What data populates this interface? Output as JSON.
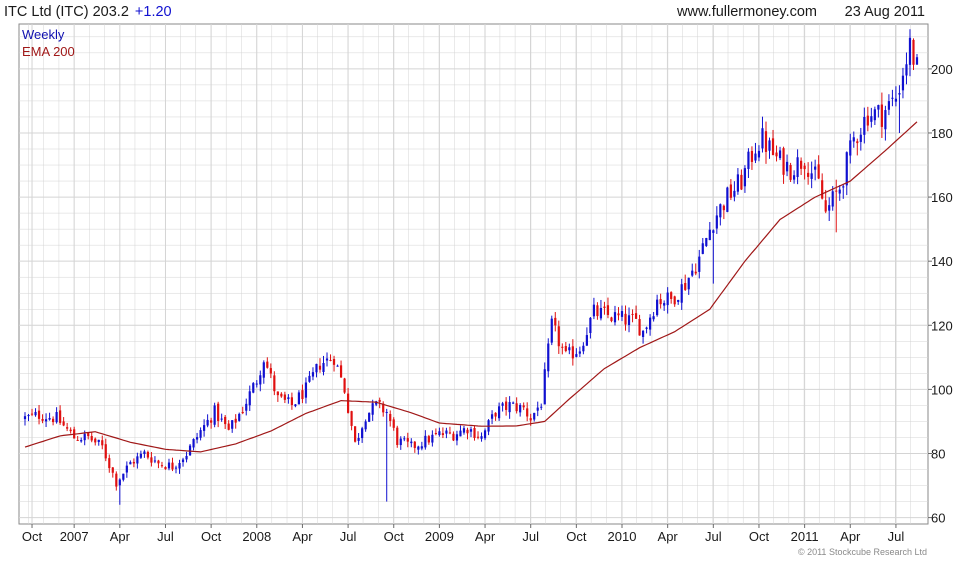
{
  "header": {
    "ticker_text": "ITC Ltd (ITC) 203.2",
    "change_text": "+1.20",
    "website": "www.fullermoney.com",
    "date": "23 Aug 2011"
  },
  "legend": {
    "period": "Weekly",
    "ema": "EMA 200"
  },
  "footer": {
    "copyright": "© 2011 Stockcube Research Ltd"
  },
  "colors": {
    "up": "#1010d0",
    "down": "#e01010",
    "ema": "#a01818",
    "grid": "#d4d4d4",
    "change_text": "#1010d0",
    "legend_period": "#1010b0",
    "legend_ema": "#a01818"
  },
  "chart_data": {
    "type": "candlestick",
    "title": "ITC Ltd (ITC) 203.2 +1.20",
    "period": "Weekly",
    "ylim": [
      58,
      214
    ],
    "y_ticks": [
      60,
      80,
      100,
      120,
      140,
      160,
      180,
      200
    ],
    "x_ticks": [
      "Oct",
      "2007",
      "Apr",
      "Jul",
      "Oct",
      "2008",
      "Apr",
      "Jul",
      "Oct",
      "2009",
      "Apr",
      "Jul",
      "Oct",
      "2010",
      "Apr",
      "Jul",
      "Oct",
      "2011",
      "Apr",
      "Jul"
    ],
    "weeks": 255,
    "tick_weeks": [
      2,
      14,
      27,
      40,
      53,
      66,
      79,
      92,
      105,
      118,
      131,
      144,
      157,
      170,
      183,
      196,
      209,
      222,
      235,
      248
    ],
    "price_anchors": [
      [
        0,
        91
      ],
      [
        4,
        92
      ],
      [
        9,
        91
      ],
      [
        14,
        85
      ],
      [
        18,
        85
      ],
      [
        22,
        82
      ],
      [
        26,
        71
      ],
      [
        30,
        77
      ],
      [
        34,
        80
      ],
      [
        38,
        77
      ],
      [
        42,
        76
      ],
      [
        46,
        80
      ],
      [
        50,
        87
      ],
      [
        54,
        93
      ],
      [
        58,
        87
      ],
      [
        62,
        94
      ],
      [
        66,
        103
      ],
      [
        68,
        110
      ],
      [
        72,
        97
      ],
      [
        76,
        95
      ],
      [
        80,
        100
      ],
      [
        84,
        108
      ],
      [
        88,
        110
      ],
      [
        91,
        100
      ],
      [
        94,
        83
      ],
      [
        97,
        92
      ],
      [
        100,
        95
      ],
      [
        103,
        93
      ],
      [
        106,
        84
      ],
      [
        110,
        82
      ],
      [
        114,
        84
      ],
      [
        118,
        86
      ],
      [
        122,
        86
      ],
      [
        126,
        88
      ],
      [
        130,
        85
      ],
      [
        134,
        93
      ],
      [
        138,
        95
      ],
      [
        142,
        94
      ],
      [
        144,
        91
      ],
      [
        147,
        96
      ],
      [
        150,
        120
      ],
      [
        154,
        110
      ],
      [
        158,
        113
      ],
      [
        162,
        124
      ],
      [
        166,
        123
      ],
      [
        170,
        122
      ],
      [
        174,
        121
      ],
      [
        176,
        118
      ],
      [
        180,
        128
      ],
      [
        184,
        128
      ],
      [
        188,
        133
      ],
      [
        192,
        141
      ],
      [
        196,
        153
      ],
      [
        200,
        160
      ],
      [
        204,
        165
      ],
      [
        208,
        176
      ],
      [
        210,
        178
      ],
      [
        214,
        172
      ],
      [
        218,
        169
      ],
      [
        222,
        172
      ],
      [
        226,
        164
      ],
      [
        228,
        155
      ],
      [
        232,
        163
      ],
      [
        236,
        178
      ],
      [
        240,
        186
      ],
      [
        244,
        186
      ],
      [
        248,
        191
      ],
      [
        252,
        207
      ],
      [
        254,
        200
      ]
    ],
    "ema_anchors": [
      [
        0,
        82
      ],
      [
        10,
        85.5
      ],
      [
        20,
        86.8
      ],
      [
        30,
        83.5
      ],
      [
        40,
        81.3
      ],
      [
        50,
        80.5
      ],
      [
        60,
        83
      ],
      [
        70,
        87
      ],
      [
        80,
        92.5
      ],
      [
        90,
        96.5
      ],
      [
        100,
        96
      ],
      [
        110,
        92.7
      ],
      [
        118,
        89.5
      ],
      [
        130,
        88.5
      ],
      [
        140,
        88.6
      ],
      [
        148,
        90
      ],
      [
        155,
        97
      ],
      [
        165,
        106.5
      ],
      [
        175,
        113
      ],
      [
        185,
        118
      ],
      [
        195,
        125
      ],
      [
        205,
        140
      ],
      [
        215,
        153
      ],
      [
        225,
        160
      ],
      [
        235,
        165
      ],
      [
        245,
        174.5
      ],
      [
        254,
        183.5
      ]
    ],
    "wick_spikes": [
      [
        27,
        64
      ],
      [
        103,
        65
      ],
      [
        196,
        133
      ],
      [
        231,
        149
      ],
      [
        249,
        180
      ]
    ]
  }
}
